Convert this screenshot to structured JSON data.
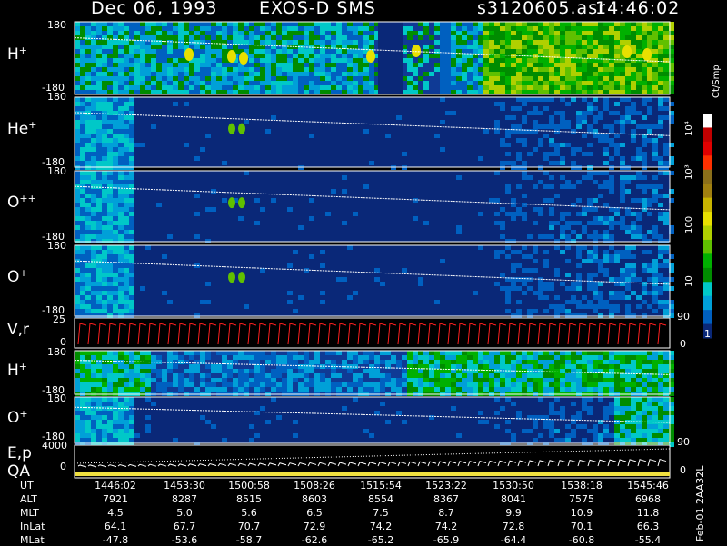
{
  "header": {
    "date": "Dec 06, 1993",
    "instrument": "EXOS-D SMS",
    "file": "s3120605.asr",
    "time": "14:46:02"
  },
  "colorbar": {
    "unit": "Ct/Smp",
    "ticks": [
      "10⁴",
      "10³",
      "100",
      "10",
      "1"
    ],
    "colors": [
      "#ffffff",
      "#c00000",
      "#e00000",
      "#ff3000",
      "#8b6f1a",
      "#a08010",
      "#c8b400",
      "#e8e000",
      "#b0d000",
      "#60c000",
      "#00b000",
      "#008c00",
      "#00c8c8",
      "#00a0d8",
      "#0060c0",
      "#0a2878"
    ]
  },
  "panels": [
    {
      "ion": "H",
      "charge": "+",
      "top": "180",
      "bottom": "-180"
    },
    {
      "ion": "He",
      "charge": "+",
      "top": "180",
      "bottom": "-180"
    },
    {
      "ion": "O",
      "charge": "++",
      "top": "180",
      "bottom": "-180"
    },
    {
      "ion": "O",
      "charge": "+",
      "top": "180",
      "bottom": "-180"
    },
    {
      "ion": "V,r",
      "charge": "",
      "top": "25",
      "bottom": "0",
      "right_top": "90",
      "right_bottom": "0"
    },
    {
      "ion": "H",
      "charge": "+",
      "top": "180",
      "bottom": "-180"
    },
    {
      "ion": "O",
      "charge": "+",
      "top": "180",
      "bottom": "-180",
      "right_bottom": "90"
    },
    {
      "ion": "E,p",
      "charge": "",
      "ion2": "QA",
      "top": "4000",
      "bottom": "0",
      "right_bottom": "0"
    }
  ],
  "side_label": "Feb-01 2AA32L",
  "table": {
    "rows": [
      {
        "label": "UT",
        "values": [
          "1446:02",
          "1453:30",
          "1500:58",
          "1508:26",
          "1515:54",
          "1523:22",
          "1530:50",
          "1538:18",
          "1545:46"
        ]
      },
      {
        "label": "ALT",
        "values": [
          "7921",
          "8287",
          "8515",
          "8603",
          "8554",
          "8367",
          "8041",
          "7575",
          "6968"
        ]
      },
      {
        "label": "MLT",
        "values": [
          "4.5",
          "5.0",
          "5.6",
          "6.5",
          "7.5",
          "8.7",
          "9.9",
          "10.9",
          "11.8"
        ]
      },
      {
        "label": "InLat",
        "values": [
          "64.1",
          "67.7",
          "70.7",
          "72.9",
          "74.2",
          "74.2",
          "72.8",
          "70.1",
          "66.3"
        ]
      },
      {
        "label": "MLat",
        "values": [
          "-47.8",
          "-53.6",
          "-58.7",
          "-62.6",
          "-65.2",
          "-65.9",
          "-64.4",
          "-60.8",
          "-55.4"
        ]
      }
    ]
  },
  "chart_data": {
    "type": "heatmap",
    "title": "Dec 06, 1993 EXOS-D SMS",
    "x_ticks_UT": [
      "1446:02",
      "1453:30",
      "1500:58",
      "1508:26",
      "1515:54",
      "1523:22",
      "1530:50",
      "1538:18",
      "1545:46"
    ],
    "panels": [
      {
        "name": "H+",
        "ylim": [
          -180,
          180
        ]
      },
      {
        "name": "He+",
        "ylim": [
          -180,
          180
        ]
      },
      {
        "name": "O++",
        "ylim": [
          -180,
          180
        ]
      },
      {
        "name": "O+",
        "ylim": [
          -180,
          180
        ]
      },
      {
        "name": "V,r",
        "ylim": [
          0,
          25
        ],
        "right_ylim": [
          0,
          90
        ]
      },
      {
        "name": "H+",
        "ylim": [
          -180,
          180
        ]
      },
      {
        "name": "O+",
        "ylim": [
          -180,
          180
        ]
      },
      {
        "name": "E,p QA",
        "ylim": [
          0,
          4000
        ]
      }
    ],
    "colorscale": {
      "unit": "Ct/Smp",
      "scale": "log",
      "range": [
        1,
        10000
      ]
    }
  }
}
